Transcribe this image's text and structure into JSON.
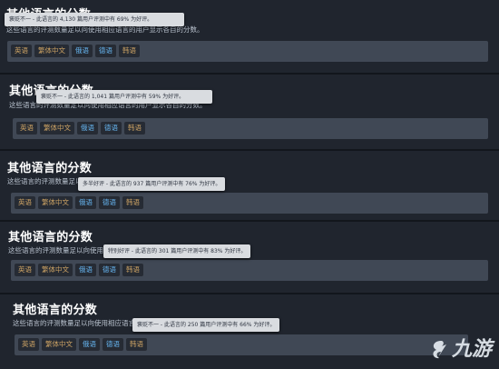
{
  "panels": [
    {
      "title": "其他语言的分数",
      "desc": "这些语言的评测数量足以向使用相应语言的用户显示各自的分数。",
      "tags": [
        "英语",
        "繁体中文",
        "俄语",
        "德语",
        "韩语"
      ],
      "tooltip": "褒贬不一 - 此语言的 4,130 篇用户评测中有 69% 为好评。"
    },
    {
      "title": "其他语言的分数",
      "desc": "这些语言的评测数量足以向使用相应语言的用户显示各自的分数。",
      "tags": [
        "英语",
        "繁体中文",
        "俄语",
        "德语",
        "韩语"
      ],
      "tooltip": "褒贬不一 - 此语言的 1,041 篇用户评测中有 59% 为好评。"
    },
    {
      "title": "其他语言的分数",
      "desc": "这些语言的评测数量足以向使用相应语言的用户显示各自的分数。",
      "tags": [
        "英语",
        "繁体中文",
        "俄语",
        "德语",
        "韩语"
      ],
      "tooltip": "多半好评 - 此语言的 937 篇用户评测中有 76% 为好评。"
    },
    {
      "title": "其他语言的分数",
      "desc": "这些语言的评测数量足以向使用相应语言的用户显示各自的分数。",
      "tags": [
        "英语",
        "繁体中文",
        "俄语",
        "德语",
        "韩语"
      ],
      "tooltip": "特别好评 - 此语言的 301 篇用户评测中有 83% 为好评。"
    },
    {
      "title": "其他语言的分数",
      "desc": "这些语言的评测数量足以向使用相应语言的用户显示各自的分数。",
      "tags": [
        "英语",
        "繁体中文",
        "俄语",
        "德语",
        "韩语"
      ],
      "tooltip": "褒贬不一 - 此语言的 250 篇用户评测中有 66% 为好评。"
    }
  ],
  "tag_colors": {
    "orange": "#c9a063",
    "blue": "#64b0ea"
  },
  "watermark": {
    "logo_text": "九游"
  }
}
